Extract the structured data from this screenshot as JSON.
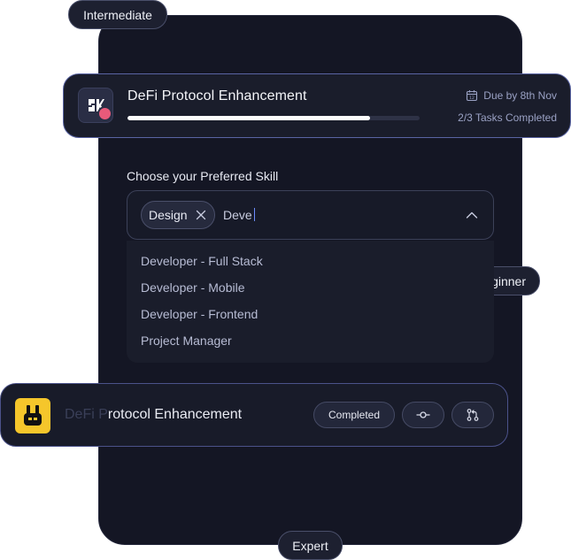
{
  "levels": {
    "intermediate": "Intermediate",
    "beginner": "Beginner",
    "expert": "Expert"
  },
  "top_project": {
    "title": "DeFi Protocol Enhancement",
    "due": "Due by 8th Nov",
    "tasks": "2/3 Tasks Completed",
    "progress": 0.83
  },
  "skill_picker": {
    "label": "Choose your Preferred Skill",
    "selected_chip": "Design",
    "query": "Deve",
    "options": [
      "Developer - Full Stack",
      "Developer - Mobile",
      "Developer - Frontend",
      "Project Manager"
    ]
  },
  "bottom_project": {
    "title_faded": "DeFi P",
    "title_rest": "rotocol Enhancement",
    "status": "Completed"
  },
  "icons": {
    "calendar": "calendar-icon",
    "close": "close-icon",
    "chevron": "chevron-up-icon",
    "commit": "git-commit-icon",
    "pull_request": "git-pull-request-icon"
  },
  "colors": {
    "panel": "#141624",
    "accent_border": "#5a64a3",
    "progress_fill": "#ffffff",
    "bunny_bg": "#f5c62b",
    "muted_text": "#9aa1c4"
  }
}
